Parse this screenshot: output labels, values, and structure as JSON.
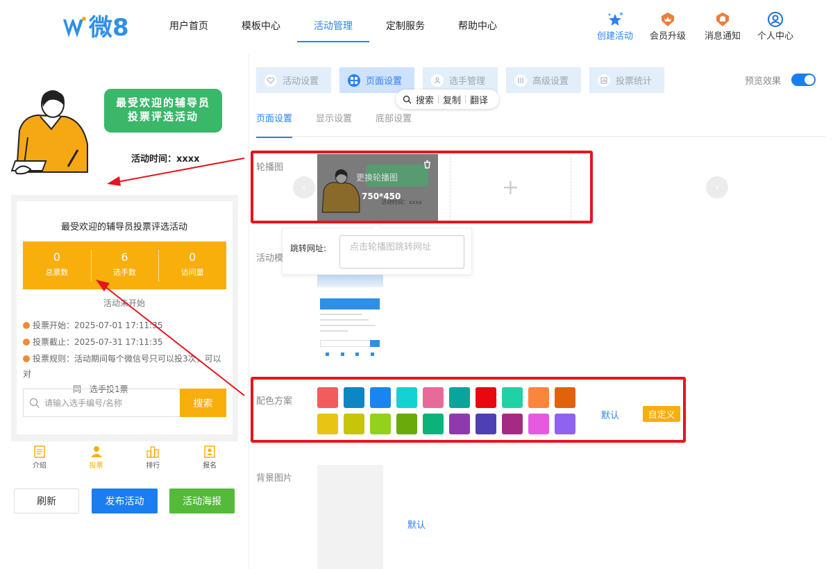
{
  "header": {
    "logo_text": "微8",
    "nav": [
      "用户首页",
      "模板中心",
      "活动管理",
      "定制服务",
      "帮助中心"
    ],
    "nav_active_index": 2,
    "quick_links": [
      {
        "label": "创建活动",
        "icon": "stars-icon",
        "color": "#2a83f2"
      },
      {
        "label": "会员升级",
        "icon": "crown-badge-icon",
        "color": "#333"
      },
      {
        "label": "消息通知",
        "icon": "bell-badge-icon",
        "color": "#333"
      },
      {
        "label": "个人中心",
        "icon": "user-circle-icon",
        "color": "#333"
      }
    ]
  },
  "preview": {
    "banner_title_line1": "最受欢迎的辅导员",
    "banner_title_line2": "投票评选活动",
    "activity_time": "活动时间：xxxx",
    "card_title": "最受欢迎的辅导员投票评选活动",
    "stats": [
      {
        "value": "0",
        "label": "总票数"
      },
      {
        "value": "6",
        "label": "选手数"
      },
      {
        "value": "0",
        "label": "访问量"
      }
    ],
    "status_text": "活动未开始",
    "vote_start": "投票开始：2025-07-01 17:11:35",
    "vote_end": "投票截止：2025-07-31 17:11:35",
    "vote_rule_line1": "投票规则：活动期间每个微信号只可以投3次，可以对",
    "vote_rule_line2": "同一选手投1票",
    "search_placeholder": "请输入选手编号/名称",
    "search_button": "搜索",
    "tabs": [
      "介绍",
      "投票",
      "排行",
      "报名"
    ],
    "tab_active_index": 1,
    "buttons": {
      "refresh": "刷新",
      "publish": "发布活动",
      "poster": "活动海报"
    }
  },
  "settings": {
    "tabs": [
      "活动设置",
      "页面设置",
      "选手管理",
      "高级设置",
      "投票统计"
    ],
    "tab_active_index": 1,
    "preview_toggle_label": "预览效果",
    "preview_toggle_on": true,
    "context_menu": [
      "搜索",
      "复制",
      "翻译"
    ],
    "subtabs": [
      "页面设置",
      "显示设置",
      "底部设置"
    ],
    "subtab_active_index": 0,
    "carousel_label": "轮播图",
    "slide_replace_text": "更换轮播图",
    "slide_size": "750*450",
    "slide_time_text": "活动时间：xxxx",
    "jump_url_label": "跳转网址:",
    "jump_url_placeholder": "点击轮播图跳转网址",
    "template_label": "活动模",
    "color_label": "配色方案",
    "colors_row1": [
      "#f25c5c",
      "#0e86c4",
      "#1a85ee",
      "#12d2d2",
      "#e76a9a",
      "#0aa59a",
      "#e8080f",
      "#1ed2a6",
      "#fb843e",
      "#e0620c"
    ],
    "colors_row2": [
      "#e8c414",
      "#c8c40a",
      "#93d11d",
      "#6aaa0a",
      "#0bb27a",
      "#8e3aad",
      "#4f3fb4",
      "#a52a84",
      "#e55ae0",
      "#9161ef"
    ],
    "color_default": "默认",
    "color_custom": "自定义",
    "bg_label": "背景图片",
    "bg_default": "默认"
  }
}
